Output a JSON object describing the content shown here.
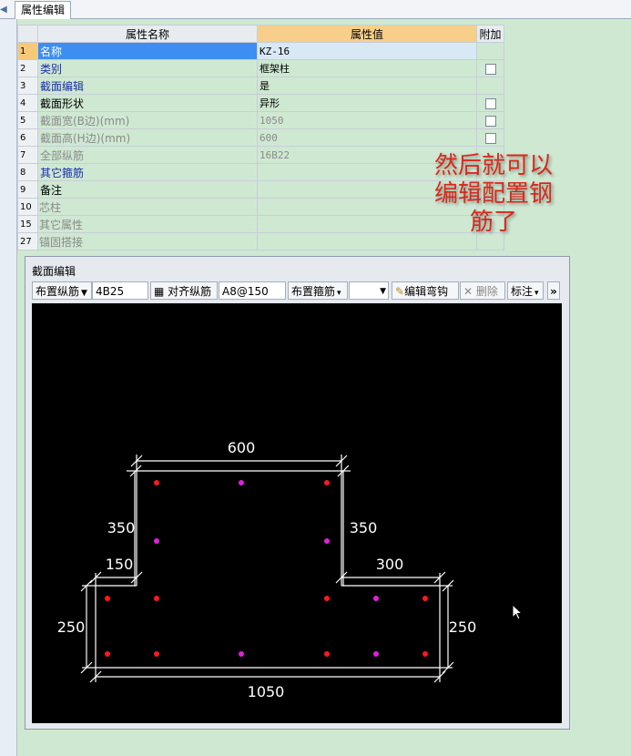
{
  "tab": {
    "label": "属性编辑"
  },
  "grid": {
    "headers": {
      "name": "属性名称",
      "value": "属性值",
      "extra": "附加"
    },
    "rows": [
      {
        "num": "1",
        "name": "名称",
        "value": "KZ-16"
      },
      {
        "num": "2",
        "name": "类别",
        "value": "框架柱"
      },
      {
        "num": "3",
        "name": "截面编辑",
        "value": "是"
      },
      {
        "num": "4",
        "name": "截面形状",
        "value": "异形"
      },
      {
        "num": "5",
        "name": "截面宽(B边)(mm)",
        "value": "1050"
      },
      {
        "num": "6",
        "name": "截面高(H边)(mm)",
        "value": "600"
      },
      {
        "num": "7",
        "name": "全部纵筋",
        "value": "16B22"
      },
      {
        "num": "8",
        "name": "其它箍筋",
        "value": ""
      },
      {
        "num": "9",
        "name": "备注",
        "value": ""
      },
      {
        "num": "10",
        "name": "芯柱",
        "value": ""
      },
      {
        "num": "15",
        "name": "其它属性",
        "value": ""
      },
      {
        "num": "27",
        "name": "锚固搭接",
        "value": ""
      }
    ]
  },
  "annotation": {
    "line1": "然后就可以",
    "line2": "编辑配置钢",
    "line3": "筋了"
  },
  "panel": {
    "title": "截面编辑",
    "toolbar": {
      "place_long_rebar": "布置纵筋",
      "long_rebar_value": "4B25",
      "align_rebar": "对齐纵筋",
      "stirrup_value": "A8@150",
      "place_stirrup": "布置箍筋",
      "edit_hook": "编辑弯钩",
      "delete": "删除",
      "annotate": "标注",
      "more": "»"
    }
  },
  "drawing": {
    "dims": {
      "top": "600",
      "left_upper": "350",
      "right_upper": "350",
      "left_step": "150",
      "right_step": "300",
      "left_lower": "250",
      "right_lower": "250",
      "bottom": "1050"
    },
    "colors": {
      "outline": "#ffffff",
      "corner_rebar": "#ff1a1a",
      "middle_rebar": "#e020e0"
    }
  }
}
